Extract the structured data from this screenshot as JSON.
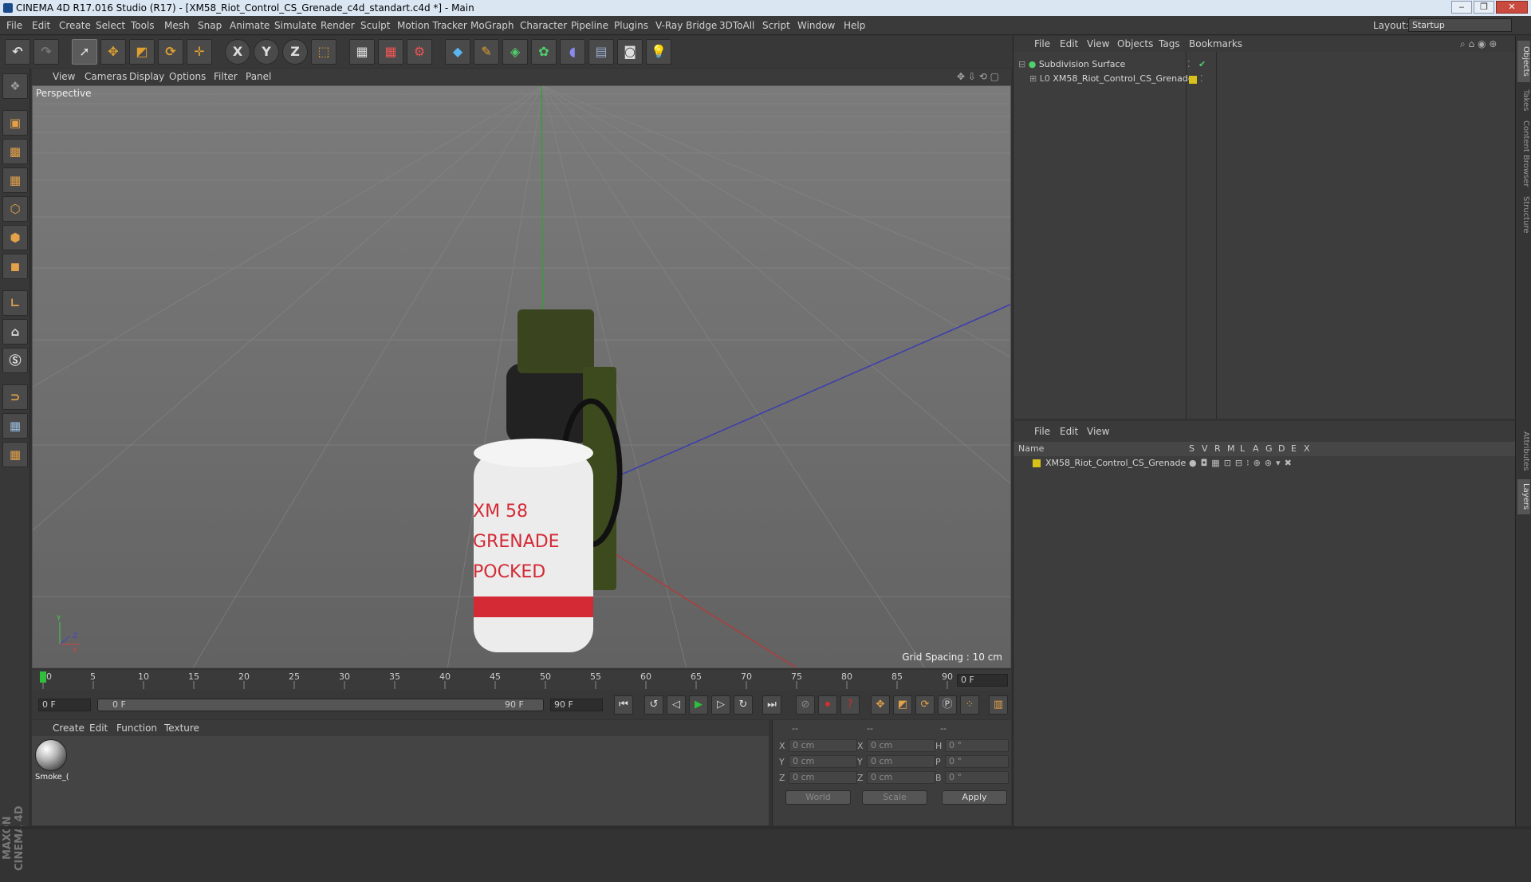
{
  "window": {
    "title": "CINEMA 4D R17.016 Studio (R17) - [XM58_Riot_Control_CS_Grenade_c4d_standart.c4d *] - Main",
    "controls": [
      "‒",
      "❐",
      "✕"
    ]
  },
  "menubar": {
    "items": [
      "File",
      "Edit",
      "Create",
      "Select",
      "Tools",
      "Mesh",
      "Snap",
      "Animate",
      "Simulate",
      "Render",
      "Sculpt",
      "Motion Tracker",
      "MoGraph",
      "Character",
      "Pipeline",
      "Plugins",
      "V-Ray Bridge",
      "3DToAll",
      "Script",
      "Window",
      "Help"
    ],
    "layout_label": "Layout:",
    "layout_value": "Startup"
  },
  "toolbar": {
    "buttons": [
      "undo-icon",
      "redo-icon",
      "select-icon",
      "move-icon",
      "scale-icon",
      "rotate-icon",
      "live-select-icon",
      "x-axis-icon",
      "y-axis-icon",
      "z-axis-icon",
      "world-coord-icon",
      "render-view-icon",
      "render-picture-queue-icon",
      "render-settings-icon",
      "cube-icon",
      "pen-icon",
      "subdivision-icon",
      "cloner-icon",
      "deformer-icon",
      "floor-icon",
      "camera-icon",
      "light-icon"
    ],
    "axis_labels": [
      "X",
      "Y",
      "Z"
    ]
  },
  "viewport": {
    "menu": [
      "View",
      "Cameras",
      "Display",
      "Options",
      "Filter",
      "Panel"
    ],
    "label": "Perspective",
    "grid_spacing": "Grid Spacing : 10 cm",
    "object_text": [
      "XM 58",
      "GRENADE",
      "POCKED"
    ],
    "axis_tripod": [
      "Y",
      "X",
      "Z"
    ]
  },
  "timeline": {
    "ticks": [
      "0",
      "5",
      "10",
      "15",
      "20",
      "25",
      "30",
      "35",
      "40",
      "45",
      "50",
      "55",
      "60",
      "65",
      "70",
      "75",
      "80",
      "85",
      "90"
    ],
    "current_frame": "0 F",
    "start_frame": "0 F",
    "range_start": "0 F",
    "range_end": "90 F",
    "end_frame": "90 F"
  },
  "material_manager": {
    "menu": [
      "Create",
      "Edit",
      "Function",
      "Texture"
    ],
    "materials": [
      "Smoke_("
    ]
  },
  "coordinates": {
    "header": [
      "--",
      "--",
      "--"
    ],
    "rows": [
      {
        "axis": "X",
        "pos": "0 cm",
        "axis2": "X",
        "size": "0 cm",
        "rot_axis": "H",
        "rot": "0 °"
      },
      {
        "axis": "Y",
        "pos": "0 cm",
        "axis2": "Y",
        "size": "0 cm",
        "rot_axis": "P",
        "rot": "0 °"
      },
      {
        "axis": "Z",
        "pos": "0 cm",
        "axis2": "Z",
        "size": "0 cm",
        "rot_axis": "B",
        "rot": "0 °"
      }
    ],
    "space": "World",
    "mode": "Scale",
    "apply": "Apply"
  },
  "object_manager": {
    "menu": [
      "File",
      "Edit",
      "View",
      "Objects",
      "Tags",
      "Bookmarks"
    ],
    "objects": [
      {
        "name": "Subdivision Surface"
      },
      {
        "name": "XM58_Riot_Control_CS_Grenade"
      }
    ]
  },
  "layer_manager": {
    "menu": [
      "File",
      "Edit",
      "View"
    ],
    "header_name": "Name",
    "columns": [
      "S",
      "V",
      "R",
      "M",
      "L",
      "A",
      "G",
      "D",
      "E",
      "X"
    ],
    "layers": [
      {
        "name": "XM58_Riot_Control_CS_Grenade",
        "color": "#d8c21a"
      }
    ]
  },
  "side_tabs": [
    "Objects",
    "Takes",
    "Content Browser",
    "Structure",
    "Attributes",
    "Layers"
  ],
  "brand": "MAXON CINEMA 4D",
  "colors": {
    "accent": "#e3a24a",
    "layer": "#d8c21a",
    "play": "#2fbf3a",
    "record": "#d03030"
  }
}
